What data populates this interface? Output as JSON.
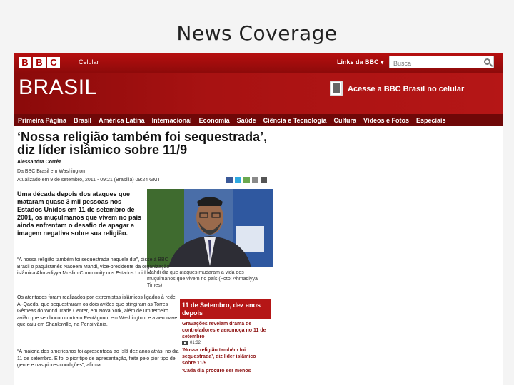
{
  "slide": {
    "title": "News Coverage"
  },
  "bbc": {
    "logo_letters": [
      "B",
      "B",
      "C"
    ],
    "celular_label": "Celular",
    "links_label": "Links da BBC ▾",
    "search_placeholder": "Busca",
    "brand": "BRASIL",
    "promo": "Acesse a BBC Brasil no celular"
  },
  "nav": [
    "Primeira Página",
    "Brasil",
    "América Latina",
    "Internacional",
    "Economia",
    "Saúde",
    "Ciência e Tecnologia",
    "Cultura",
    "Vídeos e Fotos",
    "Especiais"
  ],
  "article": {
    "headline": "‘Nossa religião também foi sequestrada’, diz líder islâmico sobre 11/9",
    "author": "Alessandra Corrêa",
    "dateline": "Da BBC Brasil em Washington",
    "updated": "Atualizado em 9 de setembro, 2011 - 09:21 (Brasília) 09:24 GMT",
    "lead": "Uma década depois dos ataques que mataram quase 3 mil pessoas nos Estados Unidos em 11 de setembro de 2001, os muçulmanos que vivem no país ainda enfrentam o desafio de apagar a imagem negativa sobre sua religião.",
    "paragraphs": [
      "“A nossa religião também foi sequestrada naquele dia”, disse à BBC Brasil o paquistanês Naseem Mahdi, vice-presidente da organização islâmica Ahmadiyya Muslim Community nos Estados Unidos.",
      "Os atentados foram realizados por extremistas islâmicos ligados à rede Al-Qaeda, que sequestraram os dois aviões que atingiram as Torres Gêmeas do World Trade Center, em Nova York, além de um terceiro avião que se chocou contra o Pentágono, em Washington, e a aeronave que caiu em Shanksville, na Pensilvânia.",
      "“A maioria dos americanos foi apresentada ao Islã dez anos atrás, no dia 11 de setembro. E foi o pior tipo de apresentação, feita pelo pior tipo de gente e nas piores condições”, afirma."
    ],
    "caption": "Mahdi diz que ataques mudaram a vida dos muçulmanos que vivem no país (Foto: Ahmadiyya Times)"
  },
  "sidebox": {
    "title": "11 de Setembro, dez anos depois",
    "links": [
      "Gravações revelam drama de controladores e aeromoça no 11 de setembro",
      "‘Nossa religião também foi sequestrada’, diz líder islâmico sobre 11/9",
      "‘Cada dia procuro ser menos"
    ],
    "video_time": "01:32"
  },
  "colors": {
    "bbc_red": "#b51616",
    "nav_dark": "#6f0808",
    "link_red": "#8b1010"
  }
}
